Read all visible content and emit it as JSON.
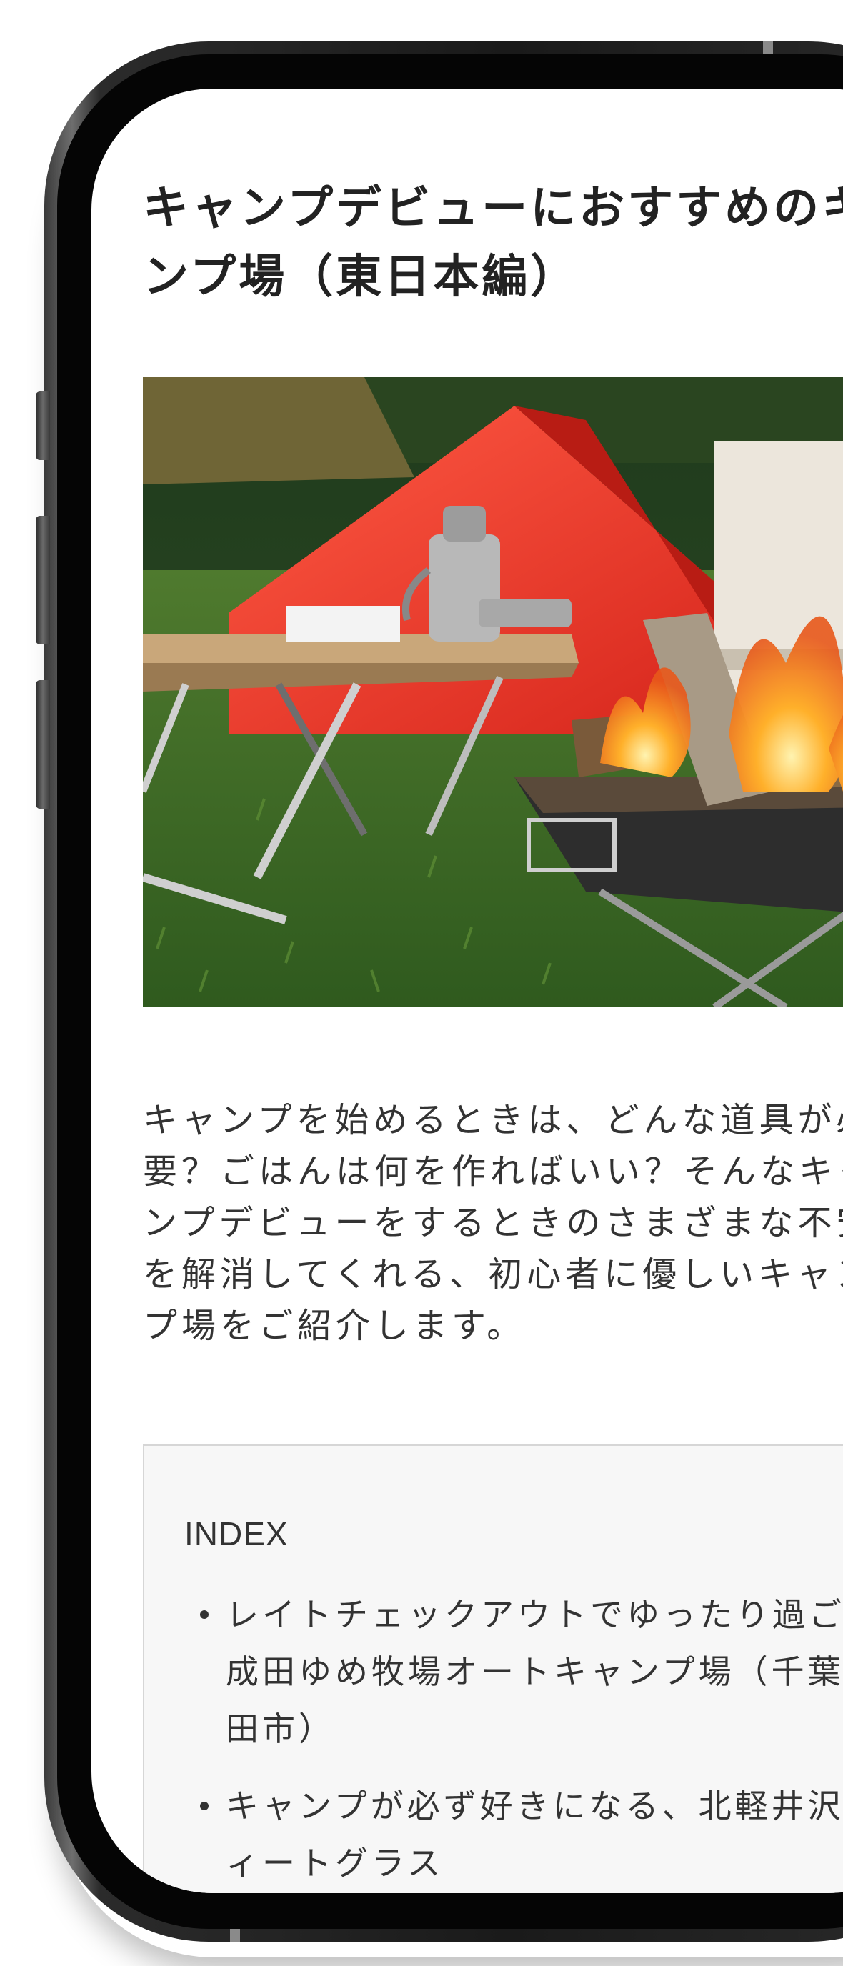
{
  "article": {
    "title": "キャンプデビューにおすすめのキャンプ場（東日本編）",
    "intro": "キャンプを始めるときは、どんな道具が必要？ごはんは何を作ればいい？そんなキャンプデビューをするときのさまざまな不安を解消してくれる、初心者に優しいキャンプ場をご紹介します。",
    "hero_image": "campfire-tent-scene"
  },
  "toc": {
    "heading": "INDEX",
    "items": [
      {
        "label": "レイトチェックアウトでゆったり過ごせる成田ゆめ牧場オートキャンプ場（千葉県成田市）"
      },
      {
        "label": "キャンプが必ず好きになる、北軽井沢スウィートグラス"
      }
    ]
  },
  "colors": {
    "text": "#333333",
    "title": "#222222",
    "toc_bg": "#f7f7f7",
    "phone_frame": "#1a1a1a"
  }
}
